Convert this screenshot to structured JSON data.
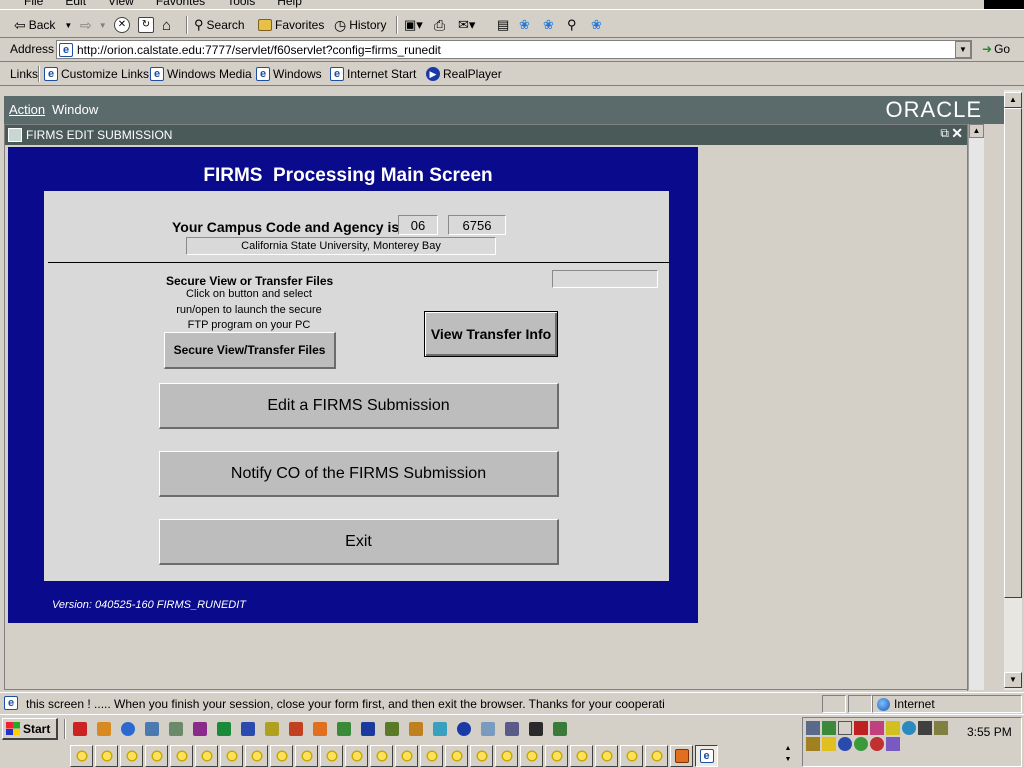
{
  "browser": {
    "menu": [
      "File",
      "Edit",
      "View",
      "Favorites",
      "Tools",
      "Help"
    ],
    "toolbar": {
      "back": "Back",
      "search": "Search",
      "favorites": "Favorites",
      "history": "History"
    },
    "address": {
      "label": "Address",
      "url": "http://orion.calstate.edu:7777/servlet/f60servlet?config=firms_runedit",
      "go": "Go"
    },
    "links": {
      "label": "Links",
      "items": [
        "Customize Links",
        "Windows Media",
        "Windows",
        "Internet Start",
        "RealPlayer"
      ]
    },
    "status": {
      "text": "this screen ! ..... When you finish your session, close your form first, and then exit the browser. Thanks for your cooperati",
      "zone": "Internet"
    }
  },
  "oracle": {
    "menu": [
      "Action",
      "Window"
    ],
    "logo": "ORACLE",
    "window_title": "FIRMS EDIT SUBMISSION"
  },
  "form": {
    "title": "FIRMS  Processing Main Screen",
    "campus_label": "Your Campus Code and Agency is:",
    "campus_code": "06",
    "agency_code": "6756",
    "campus_name": "California State University, Monterey Bay",
    "secure_heading": "Secure View or Transfer Files",
    "secure_desc": [
      "Click on button and select",
      "run/open to launch the secure",
      "FTP program on your PC"
    ],
    "secure_button": "Secure View/Transfer Files",
    "view_transfer_button": "View Transfer Info",
    "edit_button": "Edit a FIRMS Submission",
    "notify_button": "Notify CO of the FIRMS Submission",
    "exit_button": "Exit",
    "version": "Version: 040525-160 FIRMS_RUNEDIT"
  },
  "taskbar": {
    "start": "Start",
    "clock": "3:55 PM"
  },
  "colors": {
    "form_blue": "#0a0a8c",
    "panel_gray": "#d9d9d9",
    "oracle_bar": "#5b6a6a",
    "title_bar": "#4a5a58"
  }
}
